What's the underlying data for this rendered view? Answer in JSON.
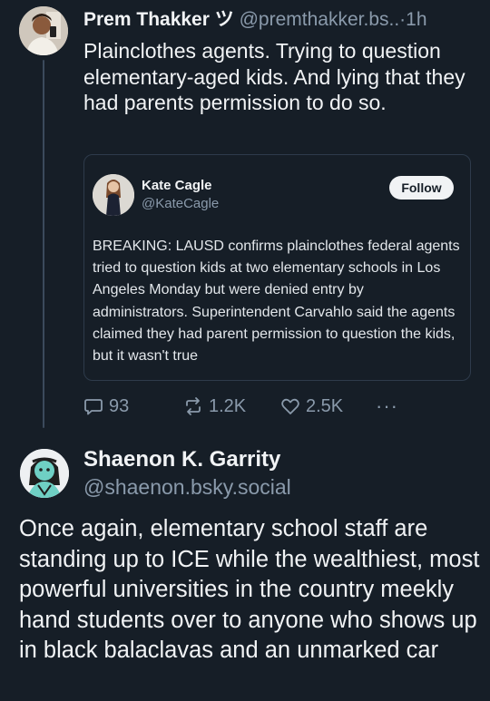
{
  "post": {
    "author_name": "Prem Thakker",
    "author_badge": "ツ",
    "author_handle": "@premthakker.bs..",
    "separator": "·",
    "time": "1h",
    "text": "Plainclothes agents. Trying to question elementary-aged kids. And lying that they had parents permission to do so.",
    "quote": {
      "name": "Kate Cagle",
      "handle": "@KateCagle",
      "follow_label": "Follow",
      "text": "BREAKING: LAUSD confirms plainclothes federal agents tried to question kids at two elementary schools in Los Angeles Monday but were denied entry by administrators. Superintendent Carvahlo said the agents claimed they had parent permission to question the kids, but it wasn't true"
    },
    "actions": {
      "replies": "93",
      "reposts": "1.2K",
      "likes": "2.5K",
      "more": "···"
    }
  },
  "reply": {
    "author_name": "Shaenon K. Garrity",
    "author_handle": "@shaenon.bsky.social",
    "text": "Once again, elementary school staff are standing up to ICE while the wealthiest, most powerful universities in the country meekly hand students over to anyone who shows up in black balaclavas and an unmarked car"
  },
  "icons": {
    "reply": "speech-bubble-icon",
    "repost": "repost-arrows-icon",
    "like": "heart-icon",
    "more": "ellipsis-icon"
  },
  "colors": {
    "background": "#161e27",
    "text": "#f1f3f5",
    "muted": "#8a9aab",
    "border": "#2e3b4b"
  }
}
